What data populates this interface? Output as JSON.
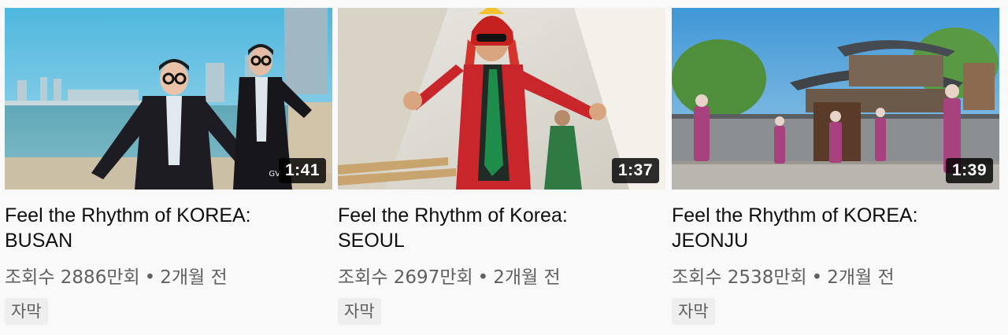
{
  "videos": [
    {
      "title_line1": "Feel the Rhythm of KOREA:",
      "title_line2": "BUSAN",
      "duration": "1:41",
      "views": "조회수 2886만회",
      "separator": "•",
      "age": "2개월 전",
      "badge": "자막",
      "watermark": "GV",
      "thumbnail_icon": "busan-beach-dancers-thumbnail"
    },
    {
      "title_line1": "Feel the Rhythm of Korea:",
      "title_line2": "SEOUL",
      "duration": "1:37",
      "views": "조회수 2697만회",
      "separator": "•",
      "age": "2개월 전",
      "badge": "자막",
      "thumbnail_icon": "seoul-red-dancer-thumbnail"
    },
    {
      "title_line1": "Feel the Rhythm of KOREA:",
      "title_line2": "JEONJU",
      "duration": "1:39",
      "views": "조회수 2538만회",
      "separator": "•",
      "age": "2개월 전",
      "badge": "자막",
      "thumbnail_icon": "jeonju-hanok-dancers-thumbnail"
    }
  ],
  "colors": {
    "page_background": "#f9f9f9",
    "title_text": "#0f0f0f",
    "meta_text": "#606060",
    "badge_background": "#eeeeee",
    "duration_background": "#000000"
  }
}
